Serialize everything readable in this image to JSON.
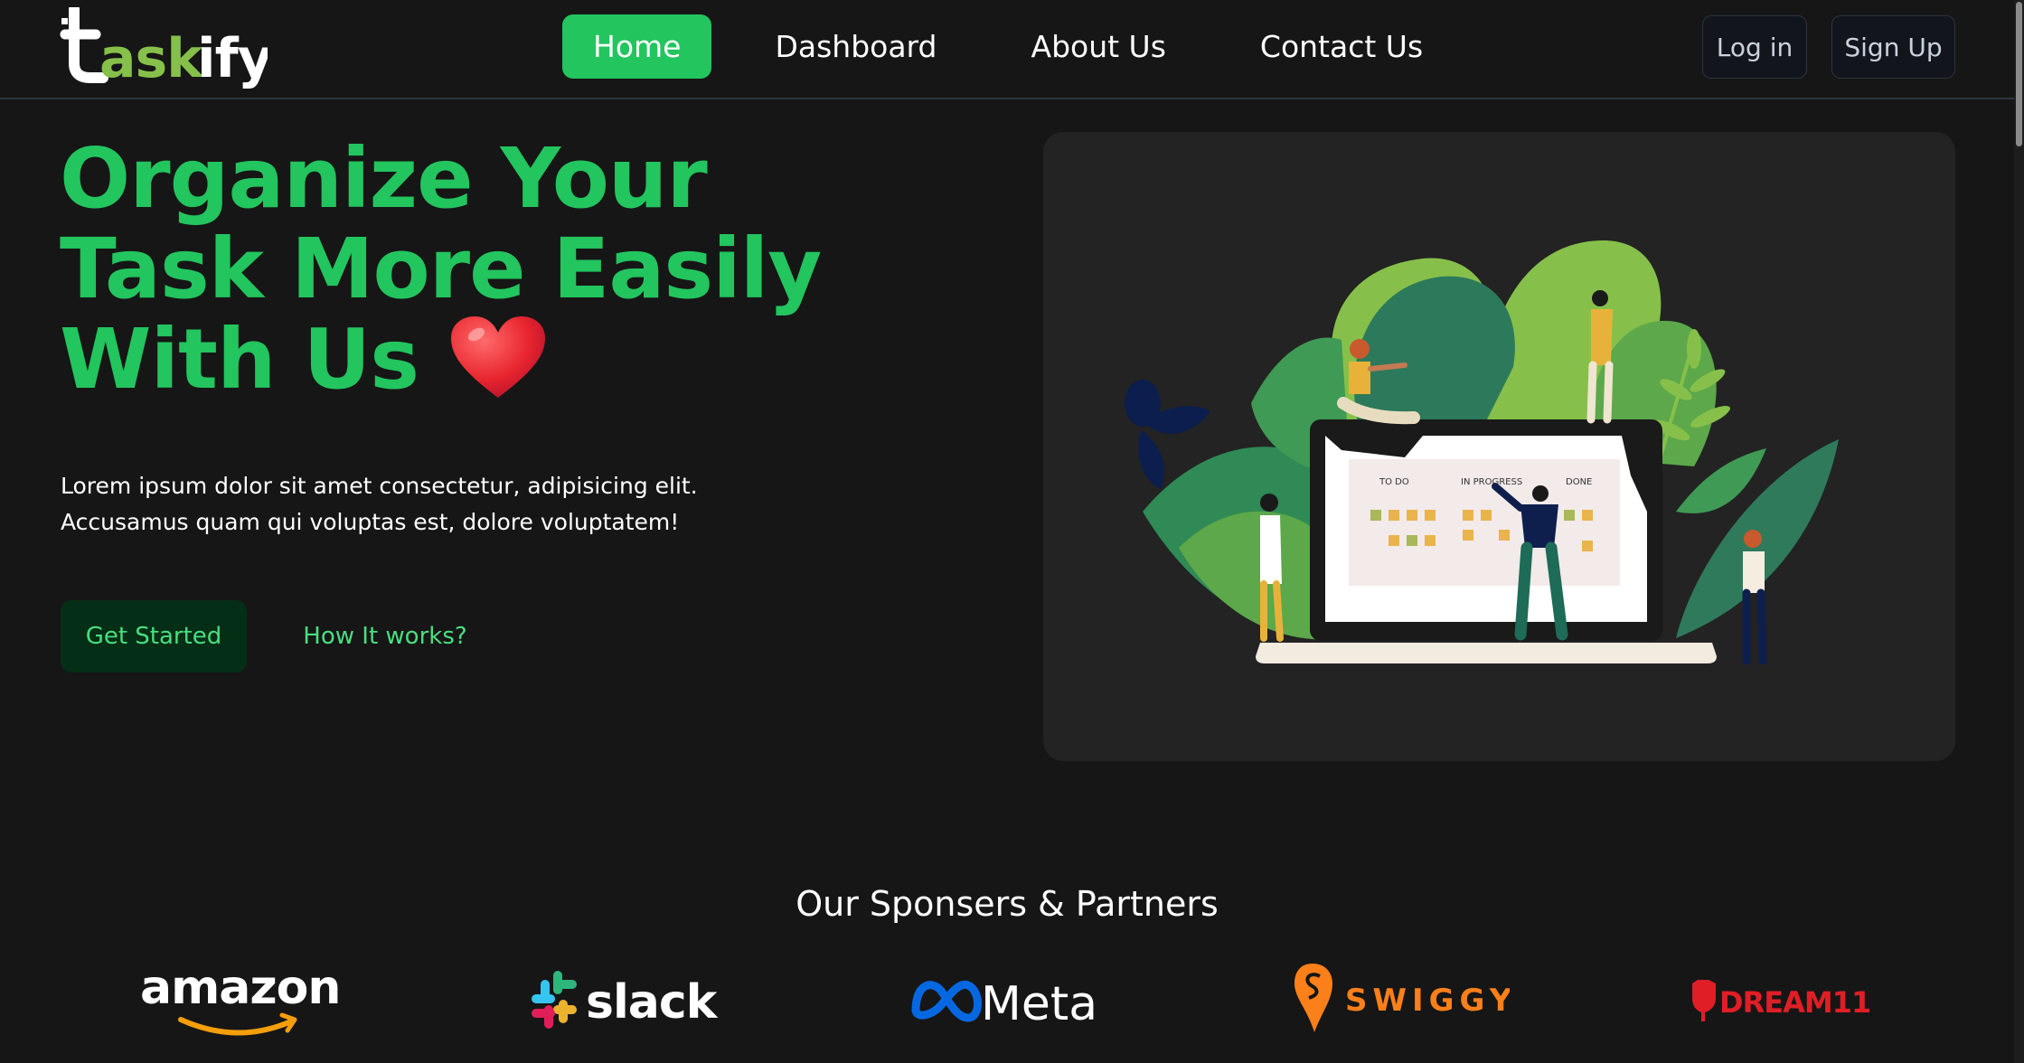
{
  "brand": {
    "logo_prefix": "t",
    "logo_rest": "askify",
    "colors": {
      "accent": "#22c55e",
      "accent_dark": "#052e16",
      "accent_text": "#4ade80",
      "background": "#161616",
      "card": "#232323"
    }
  },
  "nav": {
    "items": [
      {
        "label": "Home",
        "active": true
      },
      {
        "label": "Dashboard",
        "active": false
      },
      {
        "label": "About Us",
        "active": false
      },
      {
        "label": "Contact Us",
        "active": false
      }
    ]
  },
  "auth": {
    "login_label": "Log in",
    "signup_label": "Sign Up"
  },
  "hero": {
    "title_line1": "Organize Your",
    "title_line2": "Task More Easily",
    "title_line3": "With Us",
    "heart_icon": "red-heart-emoji",
    "description_line1": "Lorem ipsum dolor sit amet consectetur, adipisicing elit.",
    "description_line2": "Accusamus quam qui voluptas est, dolore voluptatem!",
    "primary_cta": "Get Started",
    "secondary_cta": "How It works?"
  },
  "illustration": {
    "columns": [
      "TO DO",
      "IN PROGRESS",
      "DONE"
    ]
  },
  "partners": {
    "title": "Our Sponsers & Partners",
    "items": [
      {
        "name": "amazon",
        "color": "#ffffff",
        "accent": "#f59e0b"
      },
      {
        "name": "slack",
        "color": "#ffffff"
      },
      {
        "name": "Meta",
        "color": "#ffffff",
        "accent": "#0668e1"
      },
      {
        "name": "SWIGGY",
        "color": "#fc8019"
      },
      {
        "name": "DREAM11",
        "color": "#e01e26"
      }
    ]
  }
}
